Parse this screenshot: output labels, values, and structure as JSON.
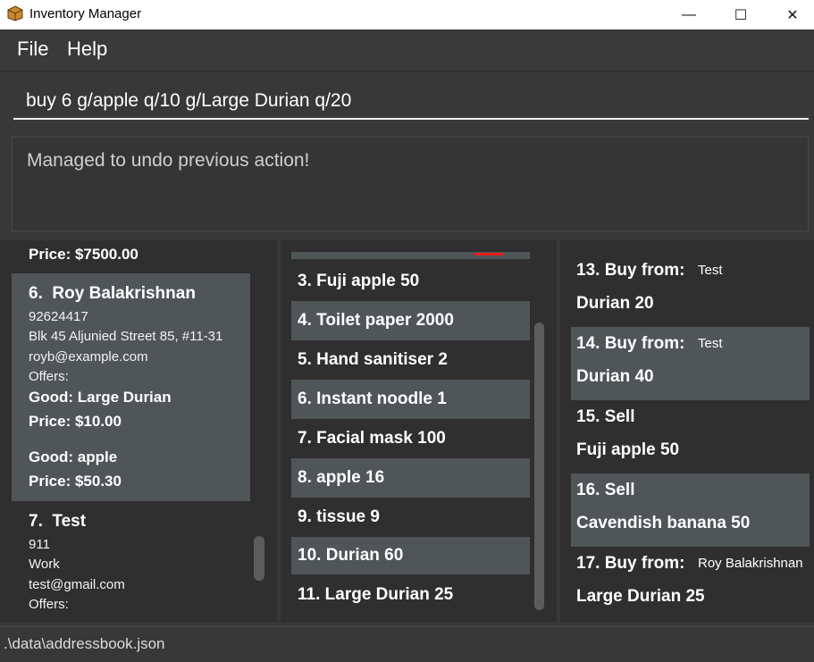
{
  "window": {
    "title": "Inventory Manager",
    "min_glyph": "—",
    "max_glyph": "☐",
    "close_glyph": "✕"
  },
  "menu": {
    "file": "File",
    "help": "Help"
  },
  "command": {
    "value": "buy 6 g/apple q/10 g/Large Durian q/20"
  },
  "result": {
    "text": "Managed to undo previous action!"
  },
  "persons": {
    "partial_price": "Price: $7500.00",
    "items": [
      {
        "index": "6.",
        "name": "Roy Balakrishnan",
        "phone": "92624417",
        "address": "Blk 45 Aljunied Street 85, #11-31",
        "email": "royb@example.com",
        "offers_label": "Offers:",
        "offers": [
          {
            "good": "Good: Large Durian",
            "price": "Price: $10.00"
          },
          {
            "good": "Good: apple",
            "price": "Price: $50.30"
          }
        ]
      },
      {
        "index": "7.",
        "name": "Test",
        "phone": "911",
        "address": "Work",
        "email": "test@gmail.com",
        "offers_label": "Offers:"
      }
    ]
  },
  "goods": [
    "3.  Fuji apple 50",
    "4.  Toilet paper 2000",
    "5.  Hand sanitiser 2",
    "6.  Instant noodle 1",
    "7.  Facial mask 100",
    "8.  apple 16",
    "9.  tissue 9",
    "10.  Durian 60",
    "11.  Large Durian 25"
  ],
  "transactions": [
    {
      "head": "13.  Buy from:",
      "party": "Test",
      "good": "Durian 20"
    },
    {
      "head": "14.  Buy from:",
      "party": "Test",
      "good": "Durian 40"
    },
    {
      "head": "15.  Sell",
      "party": "",
      "good": "Fuji apple 50"
    },
    {
      "head": "16.  Sell",
      "party": "",
      "good": "Cavendish banana 50"
    },
    {
      "head": "17.  Buy from:",
      "party": "Roy Balakrishnan",
      "good": "Large Durian 25"
    }
  ],
  "status": {
    "path": ".\\data\\addressbook.json"
  },
  "colors": {
    "background": "#383838",
    "card_alt": "#505558",
    "panel": "#2f2f2f",
    "accent_red": "#e0201e"
  }
}
